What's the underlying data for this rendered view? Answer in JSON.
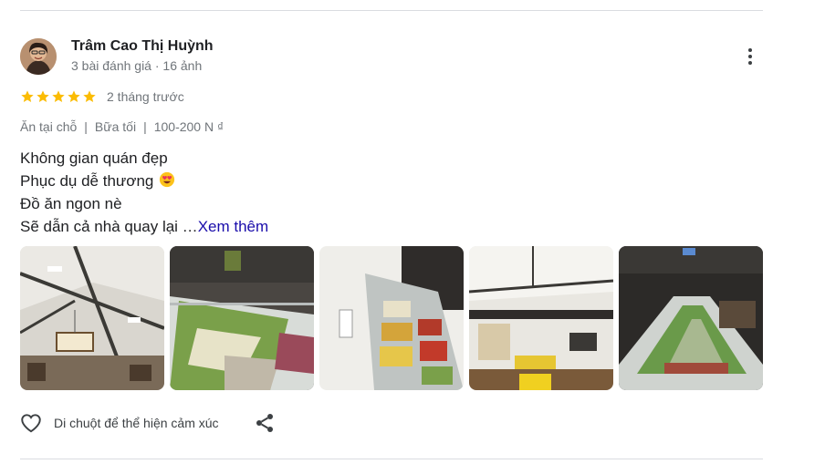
{
  "reviewer": {
    "name": "Trâm Cao Thị Huỳnh",
    "meta": "3 bài đánh giá · 16 ảnh"
  },
  "rating": {
    "stars": 5,
    "max": 5,
    "color": "#fbbc04"
  },
  "time_ago": "2 tháng trước",
  "tags": [
    "Ăn tại chỗ",
    "|",
    "Bữa tối",
    "|",
    "100-200 N ₫"
  ],
  "review_lines": [
    "Không gian quán đẹp",
    "Phục dụ dễ thương",
    "Đồ ăn ngon nè",
    "Sẽ dẫn cả nhà quay lại …"
  ],
  "emoji_icon": "heart-eyes-emoji-icon",
  "more_link": "Xem thêm",
  "photos": [
    {
      "name": "photo-ceiling-lanterns"
    },
    {
      "name": "photo-buffet-vegetables"
    },
    {
      "name": "photo-buffet-counter"
    },
    {
      "name": "photo-dining-hall"
    },
    {
      "name": "photo-long-buffet-bar"
    }
  ],
  "actions": {
    "react_label": "Di chuột để thể hiện cảm xúc",
    "react_icon": "heart-outline-icon",
    "share_icon": "share-icon"
  },
  "colors": {
    "text": "#202124",
    "secondary": "#70757a",
    "link": "#1a0dab",
    "divider": "#dadce0"
  }
}
